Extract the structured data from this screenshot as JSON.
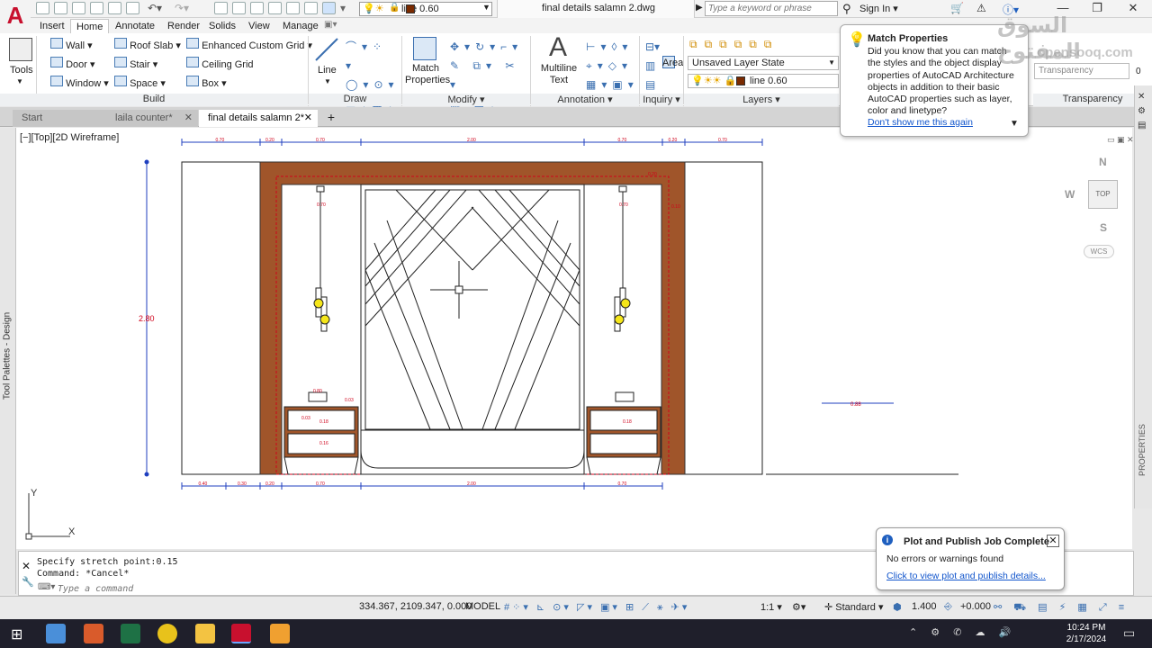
{
  "app": {
    "logo": "A",
    "document_title": "final details salamn 2.dwg",
    "search_placeholder": "Type a keyword or phrase",
    "sign_in": "Sign In",
    "layer_quick": "line 0.60",
    "window_controls": [
      "—",
      "❐",
      "✕"
    ]
  },
  "ribbon_tabs": [
    "Insert",
    "Home",
    "Annotate",
    "Render",
    "Solids",
    "View",
    "Manage"
  ],
  "ribbon": {
    "tools_label": "Tools",
    "build": {
      "title": "Build",
      "items": [
        "Wall",
        "Door",
        "Window",
        "Roof Slab",
        "Stair",
        "Space",
        "Enhanced Custom Grid",
        "Ceiling Grid",
        "Box"
      ]
    },
    "draw": {
      "title": "Draw",
      "line_label": "Line"
    },
    "modify": {
      "title": "Modify",
      "match_properties": "Match\nProperties"
    },
    "annotation": {
      "title": "Annotation",
      "multiline_text": "Multiline\nText"
    },
    "inquiry": {
      "title": "Inquiry",
      "area": "Area"
    },
    "layers": {
      "title": "Layers",
      "layer_state": "Unsaved Layer State",
      "current_layer": "line 0.60"
    },
    "transparency": {
      "title": "Transparency",
      "label": "Transparency",
      "value": "0"
    }
  },
  "doc_tabs": [
    "Start",
    "laila counter*",
    "final details salamn 2*"
  ],
  "viewport": {
    "label": "[−][Top][2D Wireframe]",
    "compass": {
      "n": "N",
      "s": "S",
      "w": "W",
      "top": "TOP",
      "wcs": "WCS"
    },
    "ucs": {
      "x": "X",
      "y": "Y"
    }
  },
  "palettes": {
    "left": "Tool Palettes - Design",
    "right": "PROPERTIES"
  },
  "drawing": {
    "height_dim": "2.80",
    "top_dims": [
      "0.70",
      "0.20",
      "0.70",
      "2.00",
      "0.70",
      "0.20",
      "0.70"
    ],
    "bottom_dims": [
      "0.40",
      "0.30",
      "0.20",
      "0.70",
      "2.00",
      "0.70"
    ],
    "side_dim": "0.88",
    "small_dims": [
      "0.70",
      "0.70",
      "0.20",
      "0.10",
      "0.80",
      "0.03",
      "0.18",
      "0.03",
      "0.16",
      "0.18"
    ]
  },
  "tip": {
    "title": "Match Properties",
    "body": "Did you know that you can match the styles and the object display properties of AutoCAD Architecture objects in addition to their basic AutoCAD properties such as layer, color and linetype?",
    "link": "Don't show me this again"
  },
  "command_line": {
    "history": [
      "Specify stretch point:0.15",
      "Command: *Cancel*"
    ],
    "placeholder": "Type a command"
  },
  "status_bar": {
    "coords": "334.367, 2109.347, 0.000",
    "space": "MODEL",
    "scale": "1:1",
    "style": "Standard",
    "lineweight": "1.400",
    "offset": "+0.000"
  },
  "notification": {
    "title": "Plot and Publish Job Complete",
    "body": "No errors or warnings found",
    "link": "Click to view plot and publish details..."
  },
  "watermark": {
    "arabic": "السوق المفتوح",
    "latin": "opensooq.com"
  },
  "clock": {
    "time": "10:24 PM",
    "date": "2/17/2024"
  },
  "colors": {
    "wood": "#a0552a",
    "dim_red": "#d0021b",
    "dim_blue": "#1f3fbf",
    "lamp": "#f5e61a",
    "accent": "#c8102e"
  }
}
